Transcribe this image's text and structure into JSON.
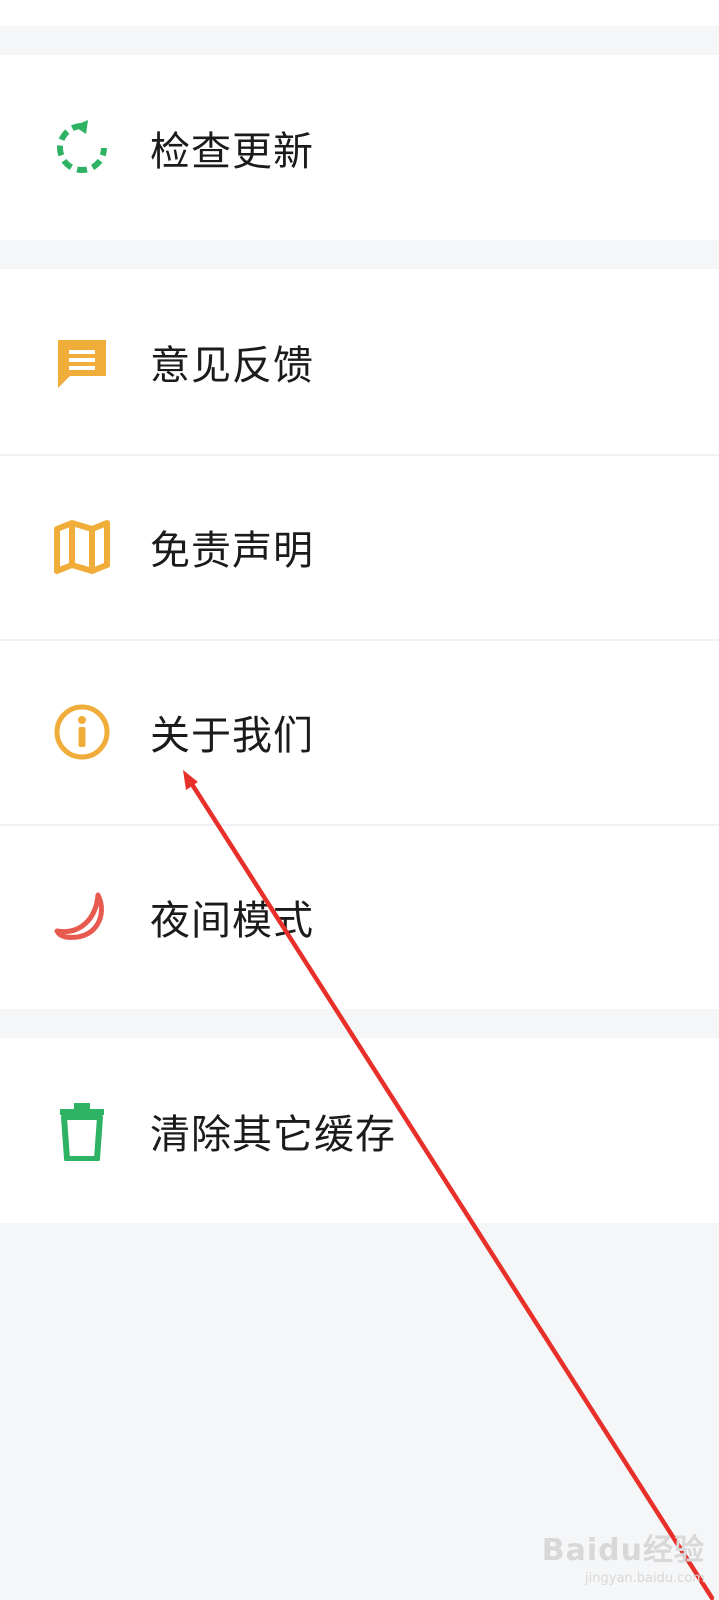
{
  "menu": {
    "group1": [
      {
        "id": "check-update",
        "label": "检查更新",
        "icon": "refresh-icon"
      }
    ],
    "group2": [
      {
        "id": "feedback",
        "label": "意见反馈",
        "icon": "message-icon"
      },
      {
        "id": "disclaimer",
        "label": "免责声明",
        "icon": "map-icon"
      },
      {
        "id": "about-us",
        "label": "关于我们",
        "icon": "info-icon"
      },
      {
        "id": "night-mode",
        "label": "夜间模式",
        "icon": "moon-icon"
      }
    ],
    "group3": [
      {
        "id": "clear-cache",
        "label": "清除其它缓存",
        "icon": "trash-icon"
      }
    ]
  },
  "colors": {
    "green": "#2db363",
    "orange": "#f0ad3a",
    "red": "#e85a4f",
    "annotation": "#e8302a"
  },
  "watermark": {
    "main": "Baidu经验",
    "sub": "jingyan.baidu.com"
  }
}
